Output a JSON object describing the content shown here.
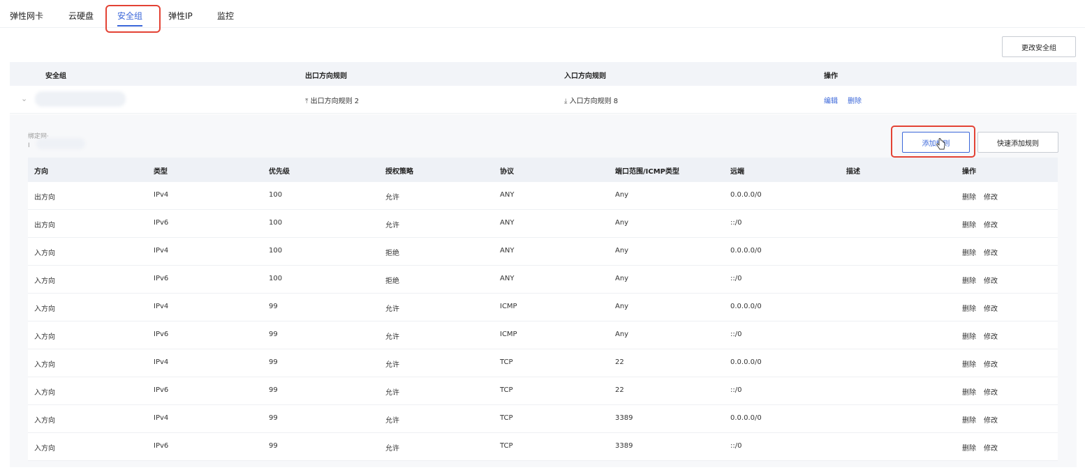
{
  "tabs": [
    {
      "label": "弹性网卡"
    },
    {
      "label": "云硬盘"
    },
    {
      "label": "安全组",
      "active": true
    },
    {
      "label": "弹性IP"
    },
    {
      "label": "监控"
    }
  ],
  "toolbar": {
    "change_sg_label": "更改安全组"
  },
  "sg_table": {
    "headers": [
      "安全组",
      "出口方向规则",
      "入口方向规则",
      "操作"
    ],
    "row": {
      "egress": "出口方向规则 2",
      "ingress": "入口方向规则 8",
      "edit": "编辑",
      "delete": "删除"
    }
  },
  "panel": {
    "bound_label": "绑定网·",
    "bound_sub": "I",
    "add_rule_label": "添加规则",
    "quick_add_label": "快速添加规则"
  },
  "rules_table": {
    "headers": [
      "方向",
      "类型",
      "优先级",
      "授权策略",
      "协议",
      "端口范围/ICMP类型",
      "远端",
      "描述",
      "操作"
    ],
    "delete_label": "删除",
    "modify_label": "修改",
    "rows": [
      {
        "direction": "出方向",
        "type": "IPv4",
        "priority": "100",
        "policy": "允许",
        "protocol": "ANY",
        "port": "Any",
        "remote": "0.0.0.0/0",
        "desc": ""
      },
      {
        "direction": "出方向",
        "type": "IPv6",
        "priority": "100",
        "policy": "允许",
        "protocol": "ANY",
        "port": "Any",
        "remote": "::/0",
        "desc": ""
      },
      {
        "direction": "入方向",
        "type": "IPv4",
        "priority": "100",
        "policy": "拒绝",
        "protocol": "ANY",
        "port": "Any",
        "remote": "0.0.0.0/0",
        "desc": ""
      },
      {
        "direction": "入方向",
        "type": "IPv6",
        "priority": "100",
        "policy": "拒绝",
        "protocol": "ANY",
        "port": "Any",
        "remote": "::/0",
        "desc": ""
      },
      {
        "direction": "入方向",
        "type": "IPv4",
        "priority": "99",
        "policy": "允许",
        "protocol": "ICMP",
        "port": "Any",
        "remote": "0.0.0.0/0",
        "desc": ""
      },
      {
        "direction": "入方向",
        "type": "IPv6",
        "priority": "99",
        "policy": "允许",
        "protocol": "ICMP",
        "port": "Any",
        "remote": "::/0",
        "desc": ""
      },
      {
        "direction": "入方向",
        "type": "IPv4",
        "priority": "99",
        "policy": "允许",
        "protocol": "TCP",
        "port": "22",
        "remote": "0.0.0.0/0",
        "desc": ""
      },
      {
        "direction": "入方向",
        "type": "IPv6",
        "priority": "99",
        "policy": "允许",
        "protocol": "TCP",
        "port": "22",
        "remote": "::/0",
        "desc": ""
      },
      {
        "direction": "入方向",
        "type": "IPv4",
        "priority": "99",
        "policy": "允许",
        "protocol": "TCP",
        "port": "3389",
        "remote": "0.0.0.0/0",
        "desc": ""
      },
      {
        "direction": "入方向",
        "type": "IPv6",
        "priority": "99",
        "policy": "允许",
        "protocol": "TCP",
        "port": "3389",
        "remote": "::/0",
        "desc": ""
      }
    ]
  },
  "colors": {
    "accent": "#3a66d9",
    "highlight": "#e34234"
  }
}
